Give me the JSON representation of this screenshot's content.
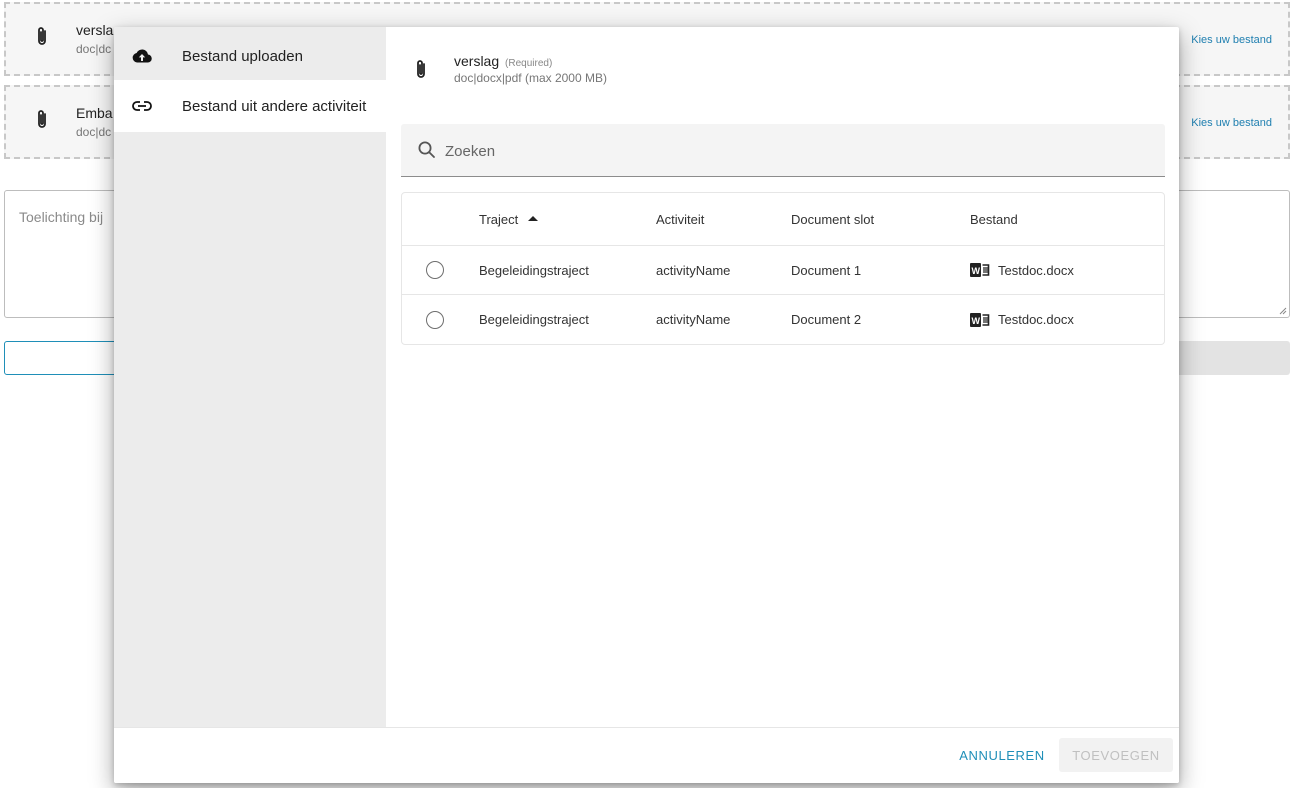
{
  "background": {
    "slots": [
      {
        "title": "versla",
        "formats": "doc|dc",
        "pick_label": "Kies uw bestand"
      },
      {
        "title": "Emba",
        "formats": "doc|dc",
        "pick_label": "Kies uw bestand"
      }
    ],
    "comment_placeholder": "Toelichting bij"
  },
  "dialog": {
    "sidebar": {
      "items": [
        {
          "label": "Bestand uploaden",
          "icon": "cloud-upload-icon"
        },
        {
          "label": "Bestand uit andere activiteit",
          "icon": "link-icon"
        }
      ]
    },
    "header": {
      "title": "verslag",
      "required": "(Required)",
      "formats": "doc|docx|pdf (max 2000 MB)"
    },
    "search": {
      "placeholder": "Zoeken"
    },
    "table": {
      "columns": [
        "Traject",
        "Activiteit",
        "Document slot",
        "Bestand"
      ],
      "sort_column": "Traject",
      "rows": [
        {
          "traject": "Begeleidingstraject",
          "activiteit": "activityName",
          "slot": "Document 1",
          "bestand": "Testdoc.docx"
        },
        {
          "traject": "Begeleidingstraject",
          "activiteit": "activityName",
          "slot": "Document 2",
          "bestand": "Testdoc.docx"
        }
      ]
    },
    "footer": {
      "cancel_label": "ANNULEREN",
      "add_label": "TOEVOEGEN"
    }
  },
  "colors": {
    "accent": "#1f8fb8",
    "sidebar_bg": "#ececec",
    "word_blue": "#222222"
  }
}
